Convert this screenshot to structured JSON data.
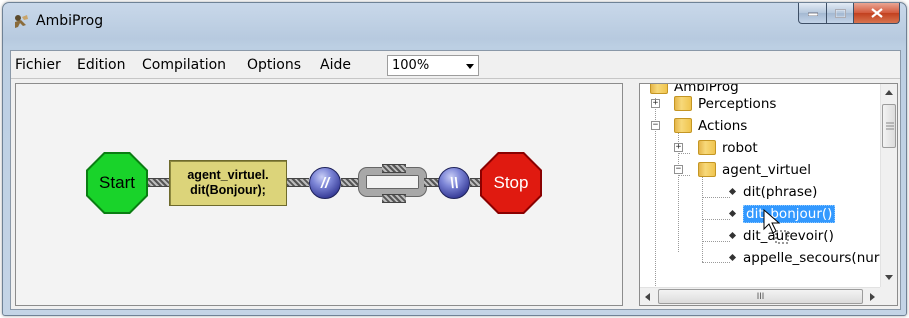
{
  "window": {
    "title": "AmbiProg",
    "icon": "ambiprog-app-icon",
    "controls": [
      "minimize-icon",
      "maximize-icon",
      "close-icon"
    ]
  },
  "menu": {
    "items": [
      "Fichier",
      "Edition",
      "Compilation",
      "Options",
      "Aide"
    ],
    "zoom": {
      "value": "100%"
    }
  },
  "canvas": {
    "start_label": "Start",
    "action_line1": "agent_virtuel.",
    "action_line2": "dit(Bonjour);",
    "parallel_open": "//",
    "parallel_close": "\\\\",
    "stop_label": "Stop",
    "colors": {
      "start": "#19d32a",
      "stop": "#e01a10",
      "action": "#dcd47a",
      "parallel": "#3a3f9a"
    }
  },
  "tree": {
    "root": "AmbiProg",
    "perceptions": "Perceptions",
    "actions": "Actions",
    "robot": "robot",
    "agent": "agent_virtuel",
    "leaves": [
      "dit(phrase)",
      "dit_bonjour()",
      "dit_aurevoir()",
      "appelle_secours(nur"
    ],
    "selected": "dit_bonjour()",
    "hscroll_grip": "III"
  }
}
